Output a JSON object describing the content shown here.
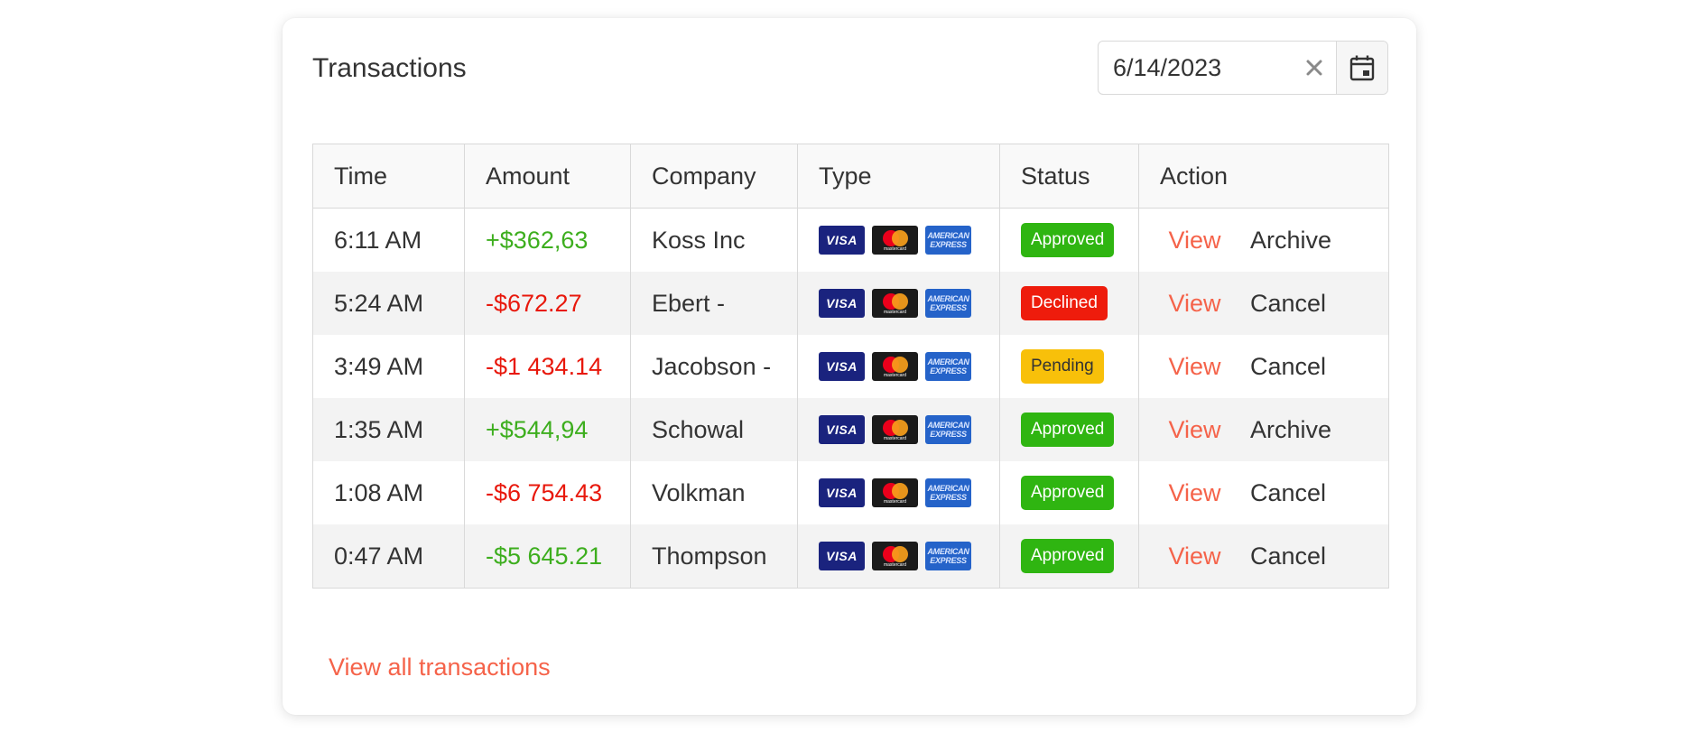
{
  "header": {
    "title": "Transactions"
  },
  "date_filter": {
    "value": "6/14/2023",
    "clear_icon": "close-icon",
    "calendar_icon": "calendar-icon"
  },
  "table": {
    "columns": [
      "Time",
      "Amount",
      "Company",
      "Type",
      "Status",
      "Action"
    ],
    "card_logos": {
      "visa": "VISA",
      "mastercard": "mastercard",
      "amex_line1": "AMERICAN",
      "amex_line2": "EXPRESS"
    },
    "rows": [
      {
        "time": "6:11 AM",
        "amount": "+$362,63",
        "amount_color": "#3dae1e",
        "company": "Koss Inc",
        "status": "Approved",
        "status_kind": "approved",
        "view": "View",
        "secondary": "Archive"
      },
      {
        "time": "5:24 AM",
        "amount": "-$672.27",
        "amount_color": "#e8180c",
        "company": "Ebert -",
        "status": "Declined",
        "status_kind": "declined",
        "view": "View",
        "secondary": "Cancel"
      },
      {
        "time": "3:49 AM",
        "amount": "-$1 434.14",
        "amount_color": "#e8180c",
        "company": "Jacobson -",
        "status": "Pending",
        "status_kind": "pending",
        "view": "View",
        "secondary": "Cancel"
      },
      {
        "time": "1:35 AM",
        "amount": "+$544,94",
        "amount_color": "#3dae1e",
        "company": "Schowal",
        "status": "Approved",
        "status_kind": "approved",
        "view": "View",
        "secondary": "Archive"
      },
      {
        "time": "1:08 AM",
        "amount": "-$6 754.43",
        "amount_color": "#e8180c",
        "company": "Volkman",
        "status": "Approved",
        "status_kind": "approved",
        "view": "View",
        "secondary": "Cancel"
      },
      {
        "time": "0:47 AM",
        "amount": "-$5 645.21",
        "amount_color": "#3dae1e",
        "company": "Thompson",
        "status": "Approved",
        "status_kind": "approved",
        "view": "View",
        "secondary": "Cancel"
      }
    ]
  },
  "footer": {
    "view_all_label": "View all transactions"
  },
  "colors": {
    "accent": "#f5634a",
    "approved": "#2fb511",
    "declined": "#ee1c0c",
    "pending": "#f8c00a",
    "mastercard_red": "#eb001b",
    "mastercard_orange": "#f79e1b"
  }
}
